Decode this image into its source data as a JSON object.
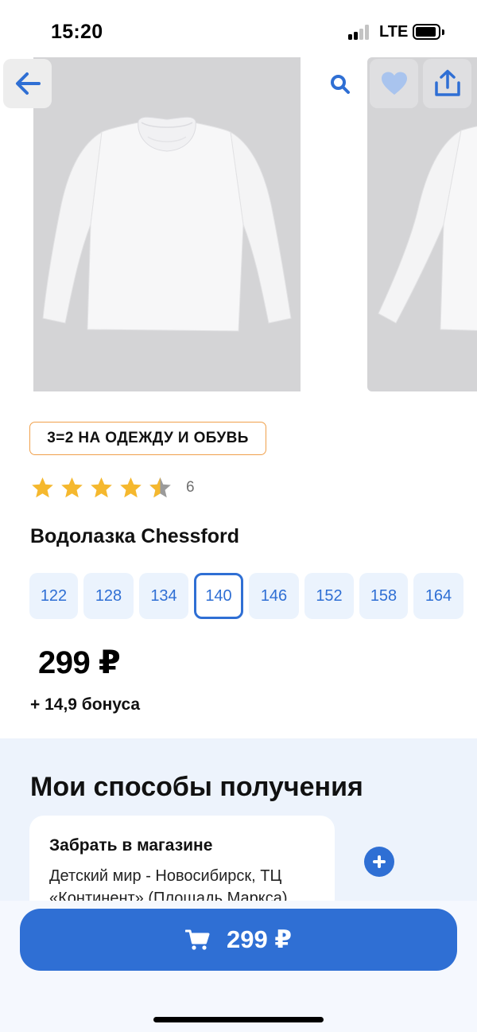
{
  "status_bar": {
    "time": "15:20",
    "network": "LTE"
  },
  "promo": {
    "label": "3=2 НА ОДЕЖДУ И ОБУВЬ",
    "border_color": "#f0a04b"
  },
  "rating": {
    "value": 4.5,
    "max": 5,
    "count": "6",
    "star_color": "#f5b82e"
  },
  "product": {
    "title": "Водолазка Chessford",
    "price": "299 ₽",
    "bonus": "+ 14,9 бонуса"
  },
  "sizes": {
    "selected": "140",
    "items": [
      {
        "label": "122"
      },
      {
        "label": "128"
      },
      {
        "label": "134"
      },
      {
        "label": "140"
      },
      {
        "label": "146"
      },
      {
        "label": "152"
      },
      {
        "label": "158"
      },
      {
        "label": "164"
      }
    ]
  },
  "delivery": {
    "title": "Мои способы получения",
    "store_card": {
      "title": "Забрать в магазине",
      "text": "Детский мир - Новосибирск, ТЦ «Континент» (Площадь Маркса)"
    }
  },
  "cart_button": {
    "price": "299 ₽"
  },
  "colors": {
    "accent": "#2f6fd4",
    "size_bg": "#ebf3fd",
    "section_bg": "#edf3fc"
  },
  "icons": [
    "arrow-left-icon",
    "search-icon",
    "heart-icon",
    "share-icon",
    "star-icon",
    "plus-icon",
    "cart-icon"
  ]
}
